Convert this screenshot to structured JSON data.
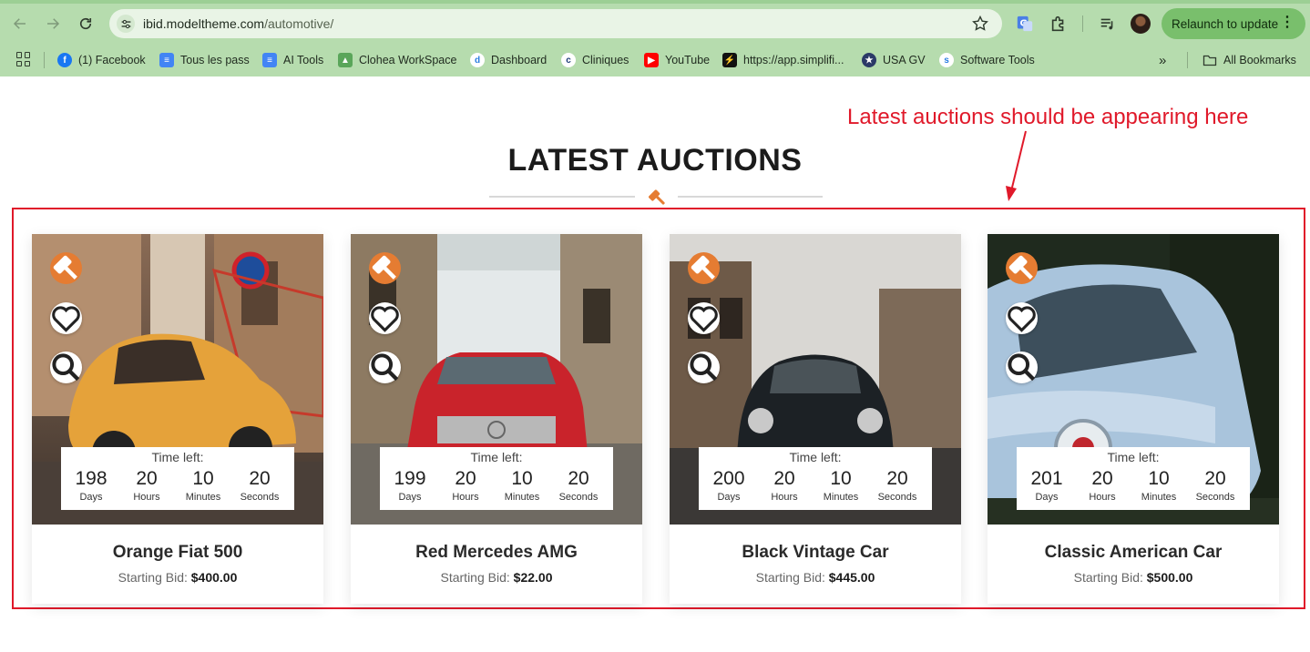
{
  "browser": {
    "url_domain": "ibid.modeltheme.com",
    "url_path": "/automotive/",
    "relaunch_label": "Relaunch to update",
    "bookmarks": [
      {
        "label": "(1) Facebook",
        "icon": "facebook-icon",
        "color": "#1877f2"
      },
      {
        "label": "Tous les pass",
        "icon": "docs-icon",
        "color": "#4285f4"
      },
      {
        "label": "AI Tools",
        "icon": "docs-icon",
        "color": "#4285f4"
      },
      {
        "label": "Clohea WorkSpace",
        "icon": "workspace-icon",
        "color": "#5aa65a"
      },
      {
        "label": "Dashboard",
        "icon": "dashboard-icon",
        "color": "#2a7de1"
      },
      {
        "label": "Cliniques",
        "icon": "cliniques-icon",
        "color": "#1d3c78"
      },
      {
        "label": "YouTube",
        "icon": "youtube-icon",
        "color": "#ff0000"
      },
      {
        "label": "https://app.simplifi...",
        "icon": "simplifi-icon",
        "color": "#111111"
      },
      {
        "label": "USA GV",
        "icon": "usa-seal-icon",
        "color": "#2b3a67"
      },
      {
        "label": "Software Tools",
        "icon": "software-tools-icon",
        "color": "#2a7de1"
      }
    ],
    "all_bookmarks_label": "All Bookmarks"
  },
  "annotation": {
    "text": "Latest auctions should be appearing here",
    "color": "#e0192a"
  },
  "section": {
    "heading": "LATEST AUCTIONS",
    "accent_color": "#e57c32"
  },
  "timer_labels": {
    "title": "Time left:",
    "days": "Days",
    "hours": "Hours",
    "minutes": "Minutes",
    "seconds": "Seconds"
  },
  "bid_label": "Starting Bid:",
  "auctions": [
    {
      "title": "Orange Fiat 500",
      "price": "$400.00",
      "days": "198",
      "hours": "20",
      "minutes": "10",
      "seconds": "20"
    },
    {
      "title": "Red Mercedes AMG",
      "price": "$22.00",
      "days": "199",
      "hours": "20",
      "minutes": "10",
      "seconds": "20"
    },
    {
      "title": "Black Vintage Car",
      "price": "$445.00",
      "days": "200",
      "hours": "20",
      "minutes": "10",
      "seconds": "20"
    },
    {
      "title": "Classic American Car",
      "price": "$500.00",
      "days": "201",
      "hours": "20",
      "minutes": "10",
      "seconds": "20"
    }
  ]
}
